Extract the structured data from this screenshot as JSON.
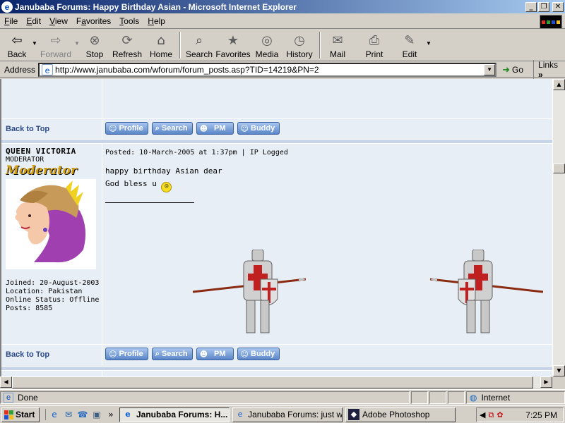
{
  "window": {
    "title": "Janubaba Forums: Happy Birthday Asian - Microsoft Internet Explorer",
    "minimize": "_",
    "maximize": "❐",
    "close": "✕"
  },
  "menu": {
    "items": [
      {
        "accel": "F",
        "rest": "ile"
      },
      {
        "accel": "E",
        "rest": "dit"
      },
      {
        "accel": "V",
        "rest": "iew"
      },
      {
        "pre": "F",
        "accel": "a",
        "rest": "vorites"
      },
      {
        "accel": "T",
        "rest": "ools"
      },
      {
        "accel": "H",
        "rest": "elp"
      }
    ]
  },
  "toolbar": {
    "back": "Back",
    "forward": "Forward",
    "stop": "Stop",
    "refresh": "Refresh",
    "home": "Home",
    "search": "Search",
    "favorites": "Favorites",
    "media": "Media",
    "history": "History",
    "mail": "Mail",
    "print": "Print",
    "edit": "Edit"
  },
  "address": {
    "label": "Address",
    "url": "http://www.janubaba.com/wforum/forum_posts.asp?TID=14219&PN=2",
    "go": "Go",
    "links": "Links"
  },
  "forum": {
    "back_to_top": "Back to Top",
    "buttons": {
      "profile": "Profile",
      "search": "Search",
      "pm": "PM",
      "buddy": "Buddy"
    },
    "post": {
      "username": "QUEEN VICTORIA",
      "user_title": "MODERATOR",
      "rank": "Moderator",
      "joined": "Joined: 20-August-2003",
      "location": "Location: Pakistan",
      "online_status": "Online Status: Offline",
      "posts": "Posts: 8585",
      "posted": "Posted: 10-March-2005 at 1:37pm | IP Logged",
      "line1": "happy birthday Asian dear",
      "line2": "God bless u"
    }
  },
  "status": {
    "text": "Done",
    "zone": "Internet"
  },
  "taskbar": {
    "start": "Start",
    "tasks": [
      "Janubaba Forums: H...",
      "Janubaba Forums: just wo...",
      "Adobe Photoshop"
    ],
    "clock": "7:25 PM"
  },
  "colors": {
    "title_gradient_start": "#0a246a",
    "forum_row_bg": "#e8eef6",
    "forum_link": "#2a4a8a",
    "rank_gold": "#d4a010"
  }
}
